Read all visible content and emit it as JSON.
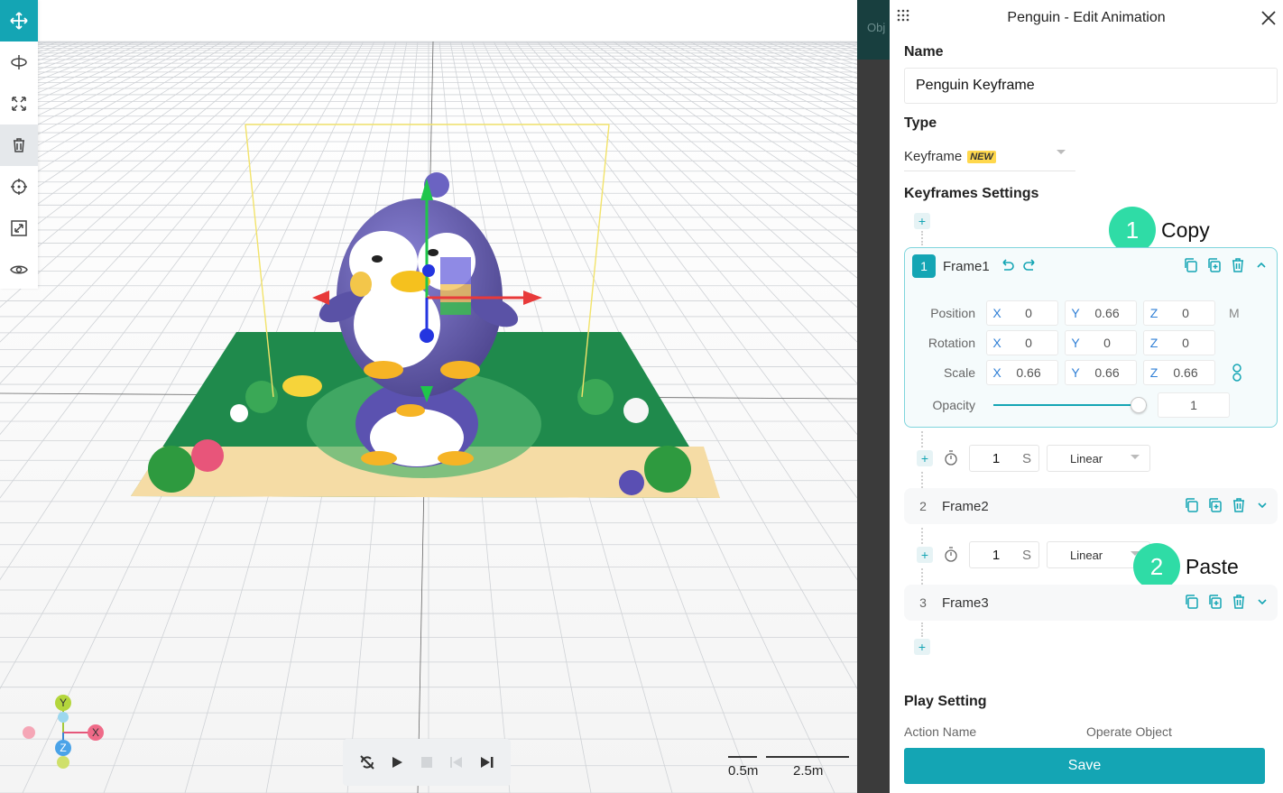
{
  "toolbar": {
    "tools": [
      "move-icon",
      "rotate-icon",
      "scale-icon",
      "trash-icon",
      "target-icon",
      "fit-icon",
      "eye-icon"
    ],
    "active_color": "#14a5b4"
  },
  "viewport": {
    "axis_labels": {
      "y": "Y",
      "x": "X",
      "z": "Z"
    },
    "scale_small": "0.5m",
    "scale_large": "2.5m"
  },
  "side_strip": {
    "label": "Obj"
  },
  "panel": {
    "title": "Penguin - Edit Animation",
    "name_label": "Name",
    "name_value": "Penguin Keyframe",
    "type_label": "Type",
    "type_value": "Keyframe",
    "type_badge": "NEW",
    "keyframes_label": "Keyframes Settings",
    "frames": [
      {
        "num": "1",
        "name": "Frame1"
      },
      {
        "num": "2",
        "name": "Frame2"
      },
      {
        "num": "3",
        "name": "Frame3"
      }
    ],
    "props": {
      "position": {
        "label": "Position",
        "x": "0",
        "y": "0.66",
        "z": "0",
        "suffix": "M"
      },
      "rotation": {
        "label": "Rotation",
        "x": "0",
        "y": "0",
        "z": "0"
      },
      "scale": {
        "label": "Scale",
        "x": "0.66",
        "y": "0.66",
        "z": "0.66"
      },
      "opacity": {
        "label": "Opacity",
        "value": "1",
        "level": 1.0
      }
    },
    "axis_letters": {
      "x": "X",
      "y": "Y",
      "z": "Z"
    },
    "timings": [
      {
        "duration": "1",
        "unit": "S",
        "easing": "Linear"
      },
      {
        "duration": "1",
        "unit": "S",
        "easing": "Linear"
      }
    ],
    "callouts": [
      {
        "num": "1",
        "text": "Copy"
      },
      {
        "num": "2",
        "text": "Paste"
      }
    ],
    "play_setting_label": "Play Setting",
    "action_name_label": "Action Name",
    "operate_object_label": "Operate Object",
    "save_label": "Save"
  },
  "colors": {
    "accent": "#14a5b4",
    "callout": "#2fdca6",
    "badge": "#ffd84d"
  }
}
